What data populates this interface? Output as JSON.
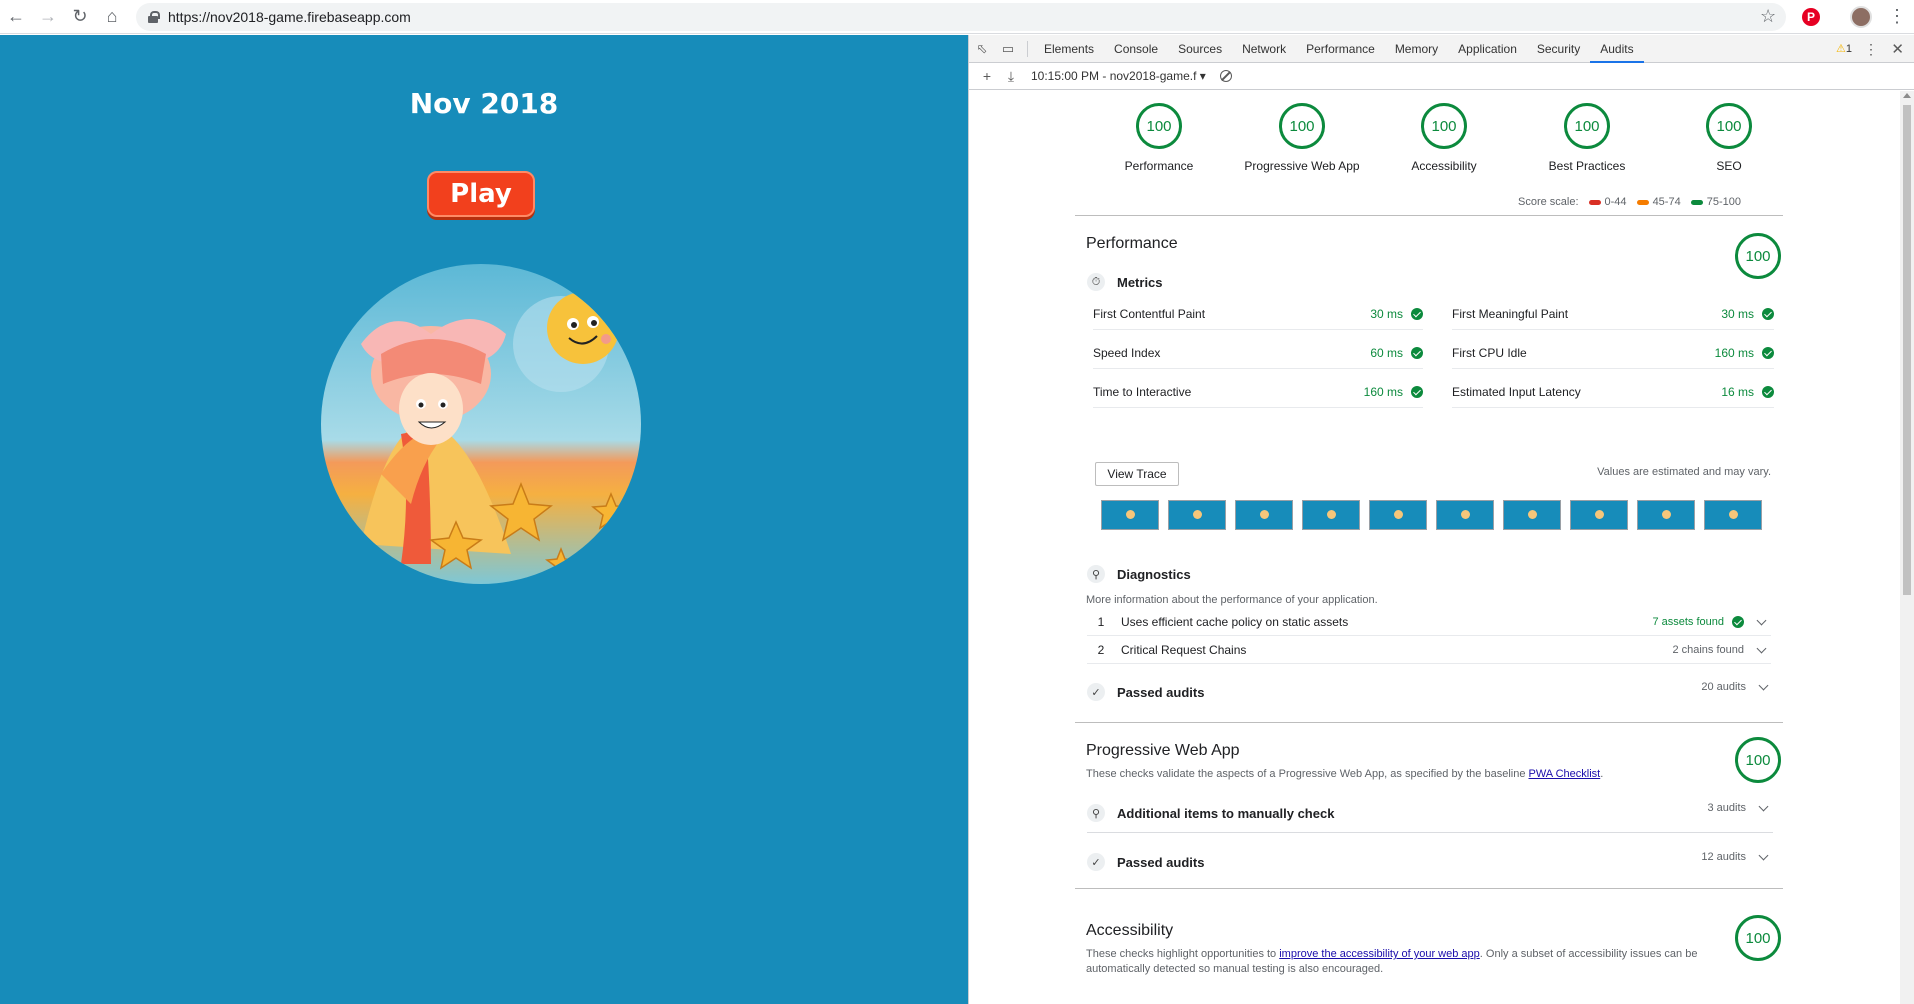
{
  "browser": {
    "url": "https://nov2018-game.firebaseapp.com",
    "back_icon": "arrow-left",
    "forward_icon": "arrow-right",
    "reload_icon": "reload",
    "home_icon": "home",
    "bookmark_icon": "star",
    "pinterest_label": "P",
    "menu_icon": "⋮"
  },
  "game": {
    "title": "Nov 2018",
    "play_label": "Play"
  },
  "devtools": {
    "tabs": [
      "Elements",
      "Console",
      "Sources",
      "Network",
      "Performance",
      "Memory",
      "Application",
      "Security",
      "Audits"
    ],
    "active_tab": "Audits",
    "warning_count": "1",
    "run_select": "10:15:00 PM - nov2018-game.f ▾"
  },
  "report": {
    "gauges": [
      {
        "score": "100",
        "label": "Performance"
      },
      {
        "score": "100",
        "label": "Progressive Web App"
      },
      {
        "score": "100",
        "label": "Accessibility"
      },
      {
        "score": "100",
        "label": "Best Practices"
      },
      {
        "score": "100",
        "label": "SEO"
      }
    ],
    "score_scale": {
      "label": "Score scale:",
      "ranges": [
        {
          "text": "0-44",
          "color": "#d93025"
        },
        {
          "text": "45-74",
          "color": "#f57c00"
        },
        {
          "text": "75-100",
          "color": "#0c8a3d"
        }
      ]
    },
    "performance": {
      "title": "Performance",
      "score": "100",
      "metrics_title": "Metrics",
      "metrics": [
        {
          "name": "First Contentful Paint",
          "value": "30 ms"
        },
        {
          "name": "First Meaningful Paint",
          "value": "30 ms"
        },
        {
          "name": "Speed Index",
          "value": "60 ms"
        },
        {
          "name": "First CPU Idle",
          "value": "160 ms"
        },
        {
          "name": "Time to Interactive",
          "value": "160 ms"
        },
        {
          "name": "Estimated Input Latency",
          "value": "16 ms"
        }
      ],
      "view_trace": "View Trace",
      "estimated_note": "Values are estimated and may vary.",
      "diagnostics_title": "Diagnostics",
      "diagnostics_desc": "More information about the performance of your application.",
      "diagnostics": [
        {
          "num": "1",
          "title": "Uses efficient cache policy on static assets",
          "value": "7 assets found"
        },
        {
          "num": "2",
          "title": "Critical Request Chains",
          "value": "2 chains found"
        }
      ],
      "passed_title": "Passed audits",
      "passed_count": "20 audits"
    },
    "pwa": {
      "title": "Progressive Web App",
      "score": "100",
      "desc": "These checks validate the aspects of a Progressive Web App, as specified by the baseline ",
      "link": "PWA Checklist",
      "desc_end": ".",
      "manual_title": "Additional items to manually check",
      "manual_count": "3 audits",
      "passed_title": "Passed audits",
      "passed_count": "12 audits"
    },
    "accessibility": {
      "title": "Accessibility",
      "score": "100",
      "desc_start": "These checks highlight opportunities to ",
      "link": "improve the accessibility of your web app",
      "desc_end": ". Only a subset of accessibility issues can be automatically detected so manual testing is also encouraged."
    }
  }
}
